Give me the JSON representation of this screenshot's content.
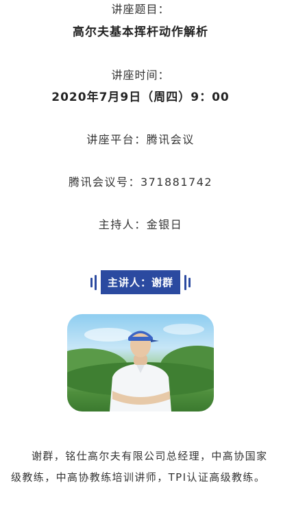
{
  "lecture": {
    "topic_label": "讲座题目：",
    "topic_value": "高尔夫基本挥杆动作解析",
    "time_label": "讲座时间：",
    "time_value": "2020年7月9日（周四）9：00",
    "platform_line": "讲座平台：腾讯会议",
    "meeting_id_line": "腾讯会议号：371881742",
    "host_line": "主持人：金银日"
  },
  "speaker": {
    "banner_label": "主讲人：谢群",
    "bio": "谢群，铭仕高尔夫有限公司总经理，中高协国家级教练，中高协教练培训讲师，TPI认证高级教练。"
  },
  "colors": {
    "accent": "#2b4aa0",
    "text": "#333333"
  }
}
